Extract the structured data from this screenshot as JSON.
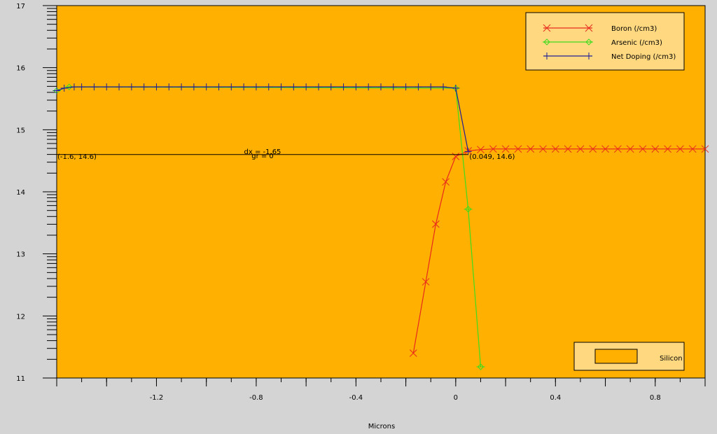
{
  "chart_data": {
    "type": "line",
    "title": "",
    "xlabel": "Microns",
    "ylabel": "",
    "xlim": [
      -1.6,
      1.0
    ],
    "ylim": [
      11,
      17
    ],
    "xticks": [
      -1.2,
      -0.8,
      -0.4,
      0,
      0.4,
      0.8
    ],
    "xtick_labels": [
      "-1.2",
      "-0.8",
      "-0.4",
      "0",
      "0.4",
      "0.8"
    ],
    "yticks": [
      11,
      12,
      13,
      14,
      15,
      16,
      17
    ],
    "ytick_labels": [
      "11",
      "12",
      "13",
      "14",
      "15",
      "16",
      "17"
    ],
    "grid": false,
    "legend_position": "top-right",
    "background_color": "#ffb000",
    "series": [
      {
        "name": "Boron (/cm3)",
        "color": "#e8281e",
        "marker": "x",
        "x": [
          -0.17,
          -0.12,
          -0.08,
          -0.04,
          0.0,
          0.05,
          0.1,
          0.15,
          0.2,
          0.25,
          0.3,
          0.35,
          0.4,
          0.45,
          0.5,
          0.55,
          0.6,
          0.65,
          0.7,
          0.75,
          0.8,
          0.85,
          0.9,
          0.95,
          1.0
        ],
        "y": [
          11.4,
          12.55,
          13.48,
          14.16,
          14.57,
          14.66,
          14.68,
          14.69,
          14.69,
          14.69,
          14.69,
          14.69,
          14.69,
          14.69,
          14.69,
          14.69,
          14.69,
          14.69,
          14.69,
          14.69,
          14.69,
          14.69,
          14.69,
          14.69,
          14.69
        ]
      },
      {
        "name": "Arsenic (/cm3)",
        "color": "#3cdc1e",
        "marker": "diamond",
        "x": [
          -1.6,
          -1.55,
          0.0,
          0.05,
          0.1
        ],
        "y": [
          15.63,
          15.69,
          15.67,
          13.72,
          11.18
        ]
      },
      {
        "name": "Net Doping (/cm3)",
        "color": "#1e1e96",
        "marker": "plus",
        "x": [
          -1.6,
          -1.57,
          -1.53,
          -1.5,
          -1.45,
          -1.4,
          -1.35,
          -1.3,
          -1.25,
          -1.2,
          -1.15,
          -1.1,
          -1.05,
          -1.0,
          -0.95,
          -0.9,
          -0.85,
          -0.8,
          -0.75,
          -0.7,
          -0.65,
          -0.6,
          -0.55,
          -0.5,
          -0.45,
          -0.4,
          -0.35,
          -0.3,
          -0.25,
          -0.2,
          -0.15,
          -0.1,
          -0.05,
          0.0,
          0.05
        ],
        "y": [
          15.63,
          15.67,
          15.69,
          15.69,
          15.69,
          15.69,
          15.69,
          15.69,
          15.69,
          15.69,
          15.69,
          15.69,
          15.69,
          15.69,
          15.69,
          15.69,
          15.69,
          15.69,
          15.69,
          15.69,
          15.69,
          15.69,
          15.69,
          15.69,
          15.69,
          15.69,
          15.69,
          15.69,
          15.69,
          15.69,
          15.69,
          15.69,
          15.69,
          15.67,
          14.65
        ]
      }
    ],
    "material_legend": {
      "label": "Silicon",
      "color": "#ffb000"
    },
    "annotations": {
      "ruler_y": 14.6,
      "ruler_x1": -1.6,
      "ruler_x2": 0.049,
      "left_label": "(-1.6, 14.6)",
      "right_label": "(0.049, 14.6)",
      "dx_label": "dx = -1.65",
      "gr_label": "gr = 0"
    }
  }
}
